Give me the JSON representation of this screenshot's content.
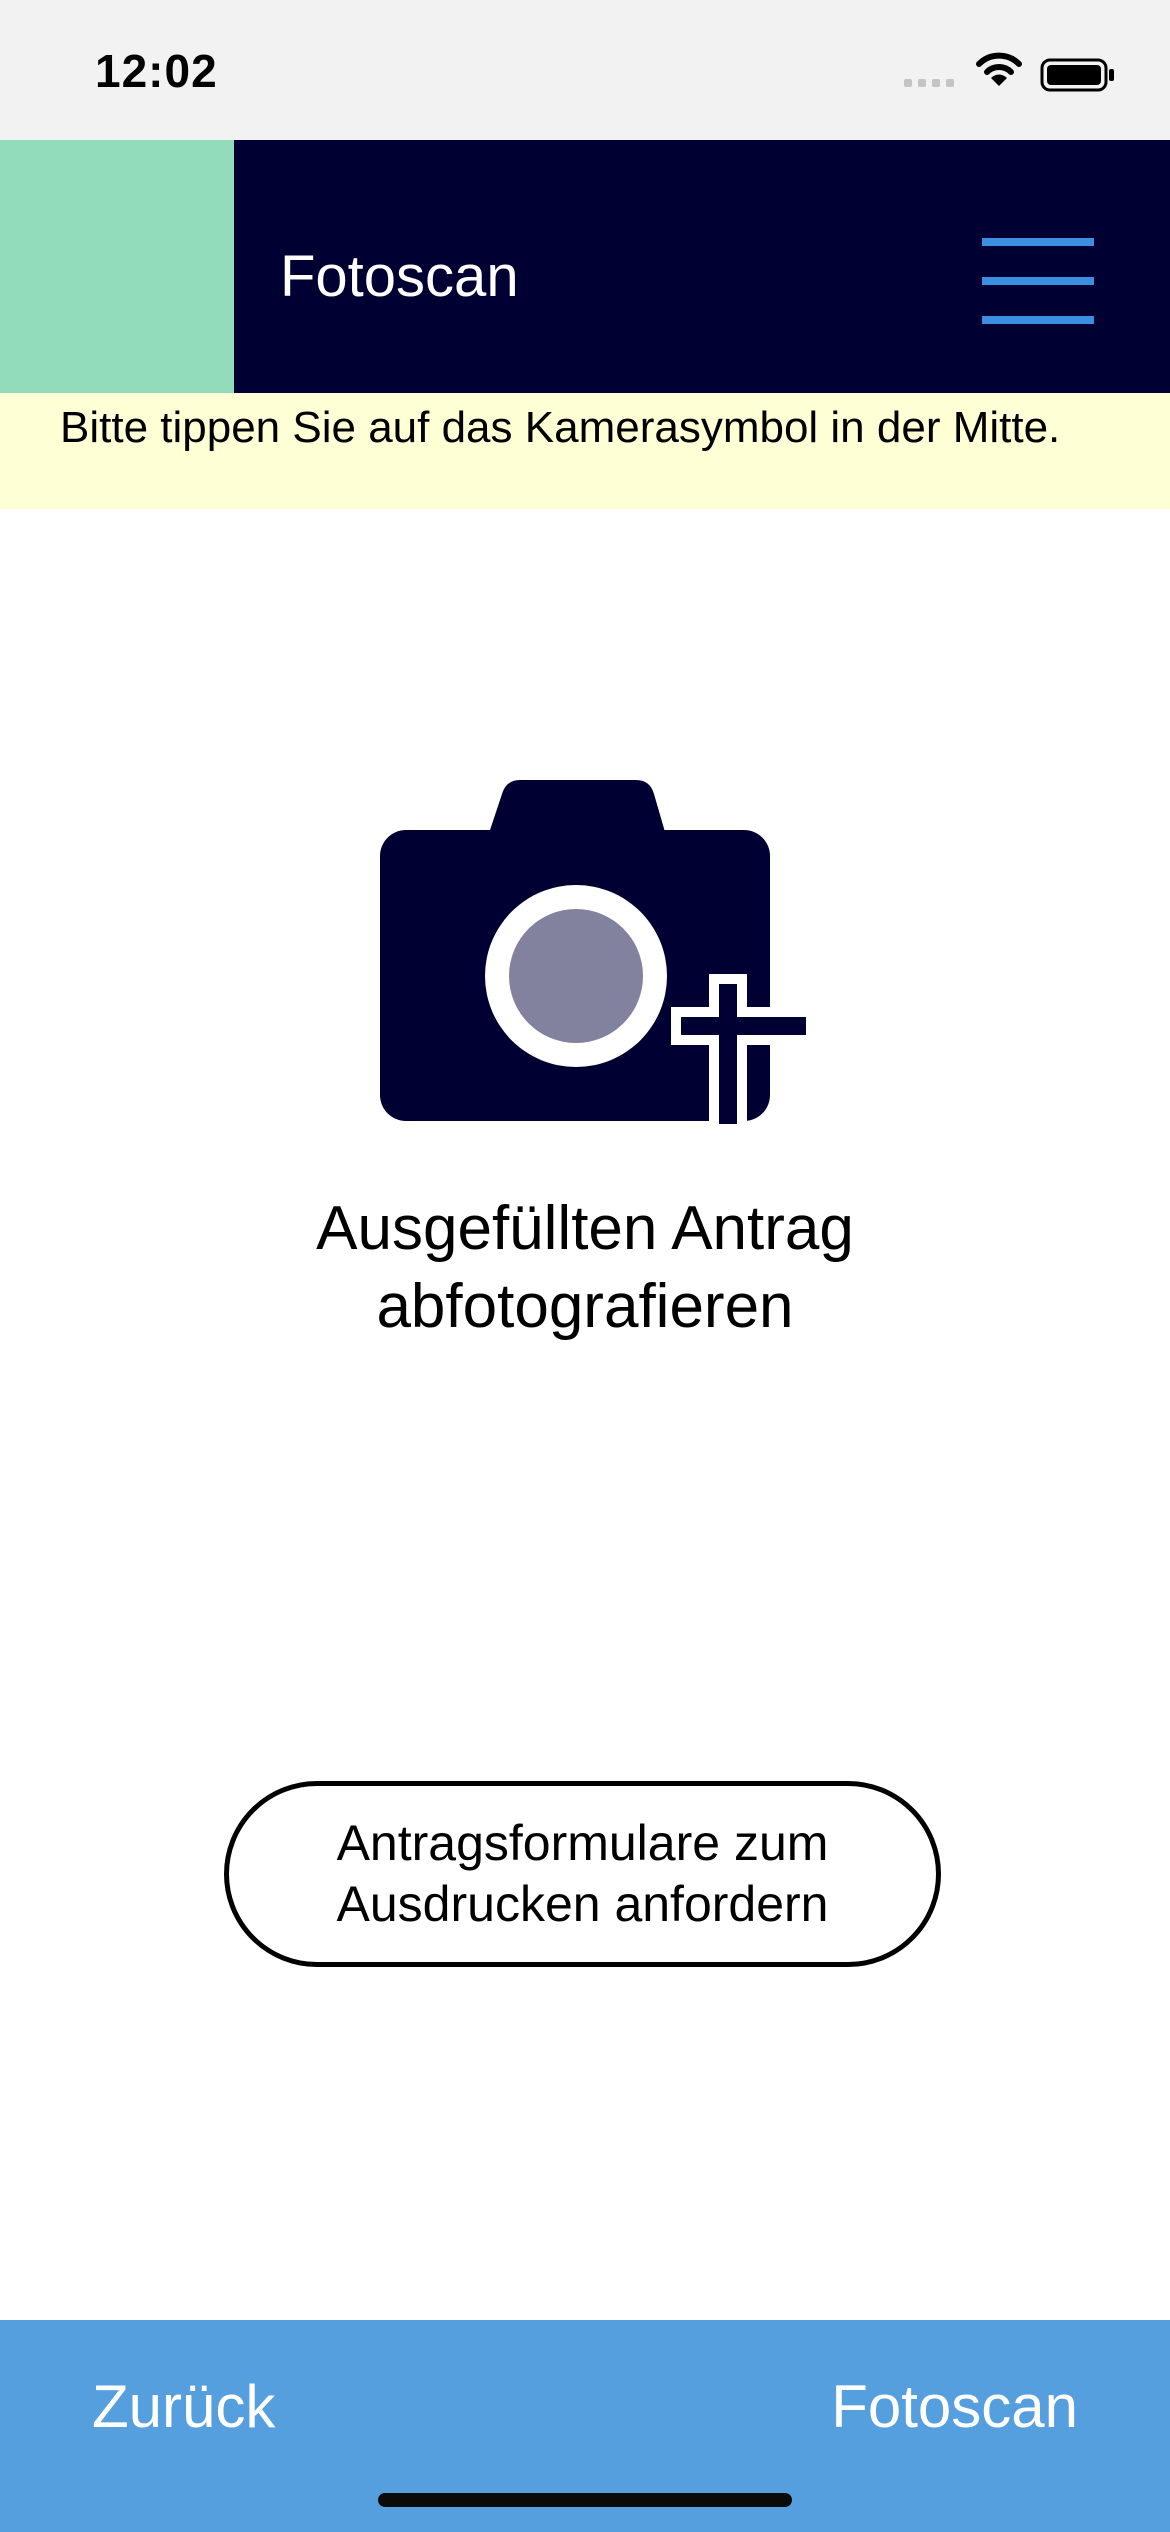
{
  "status_bar": {
    "time": "12:02"
  },
  "header": {
    "title": "Fotoscan",
    "menu_icon": "hamburger-menu-icon"
  },
  "hint": {
    "text": "Bitte tippen Sie auf das Kamerasymbol in der Mitte."
  },
  "main": {
    "camera_icon": "camera-plus-icon",
    "camera_caption": "Ausgefüllten Antrag abfotografieren",
    "request_button_label": "Antragsformulare zum Ausdrucken anfordern"
  },
  "bottom_nav": {
    "back_label": "Zurück",
    "fotoscan_label": "Fotoscan"
  },
  "colors": {
    "header_background": "#010033",
    "logo_tile": "#92dcbc",
    "menu_icon": "#3b8fe0",
    "hint_background": "#ffffd6",
    "bottom_bar": "#559fdf",
    "camera_body": "#010033",
    "camera_lens": "#83829e"
  }
}
